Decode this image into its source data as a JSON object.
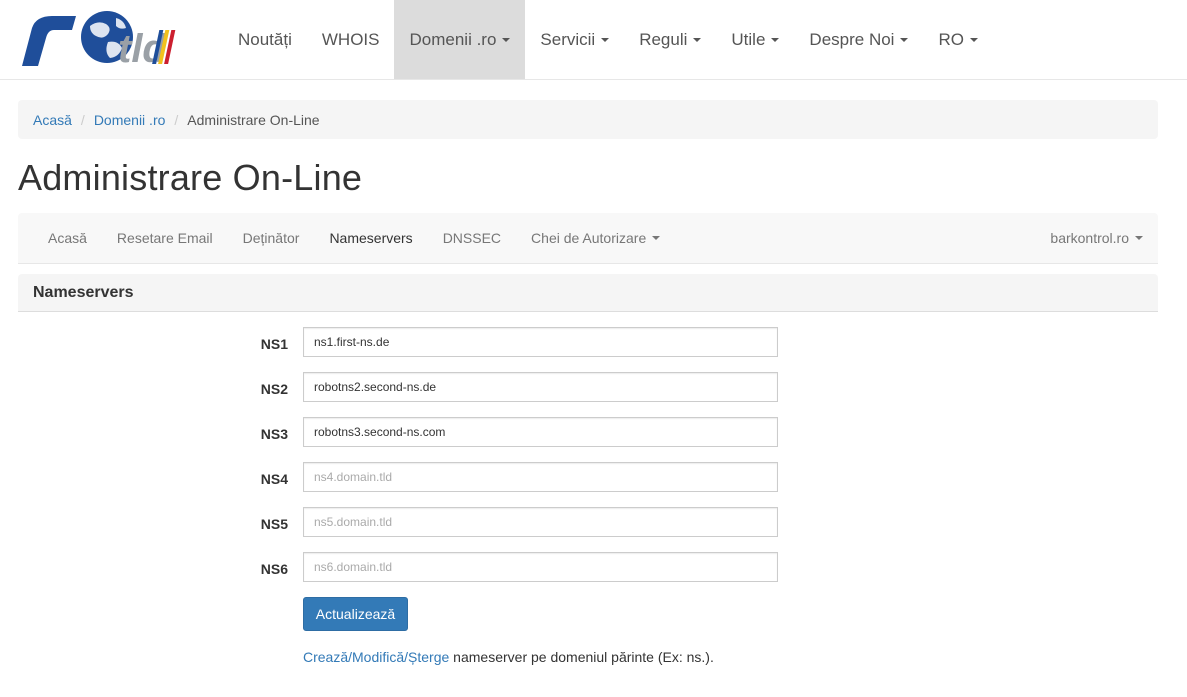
{
  "logo": {
    "text": "rotld"
  },
  "topnav": {
    "items": [
      {
        "label": "Noutăți",
        "has_caret": false,
        "active": false
      },
      {
        "label": "WHOIS",
        "has_caret": false,
        "active": false
      },
      {
        "label": "Domenii .ro",
        "has_caret": true,
        "active": true
      },
      {
        "label": "Servicii",
        "has_caret": true,
        "active": false
      },
      {
        "label": "Reguli",
        "has_caret": true,
        "active": false
      },
      {
        "label": "Utile",
        "has_caret": true,
        "active": false
      },
      {
        "label": "Despre Noi",
        "has_caret": true,
        "active": false
      },
      {
        "label": "RO",
        "has_caret": true,
        "active": false
      }
    ]
  },
  "breadcrumb": {
    "home": "Acasă",
    "section": "Domenii .ro",
    "current": "Administrare On-Line",
    "separator": "/"
  },
  "page": {
    "title": "Administrare On-Line"
  },
  "subnav": {
    "items": [
      {
        "label": "Acasă"
      },
      {
        "label": "Resetare Email"
      },
      {
        "label": "Deținător"
      },
      {
        "label": "Nameservers"
      },
      {
        "label": "DNSSEC"
      },
      {
        "label": "Chei de Autorizare"
      }
    ],
    "active": "Nameservers",
    "domain_selector": "barkontrol.ro"
  },
  "panel": {
    "title": "Nameservers"
  },
  "form": {
    "fields": [
      {
        "label": "NS1",
        "value": "ns1.first-ns.de",
        "placeholder": ""
      },
      {
        "label": "NS2",
        "value": "robotns2.second-ns.de",
        "placeholder": ""
      },
      {
        "label": "NS3",
        "value": "robotns3.second-ns.com",
        "placeholder": ""
      },
      {
        "label": "NS4",
        "value": "",
        "placeholder": "ns4.domain.tld"
      },
      {
        "label": "NS5",
        "value": "",
        "placeholder": "ns5.domain.tld"
      },
      {
        "label": "NS6",
        "value": "",
        "placeholder": "ns6.domain.tld"
      }
    ],
    "submit_label": "Actualizează"
  },
  "note": {
    "link_text": "Crează/Modifică/Șterge",
    "text": " nameserver pe domeniul părinte (Ex: ns.)."
  },
  "colors": {
    "link": "#337ab7",
    "primary_button": "#337ab7",
    "active_nav_bg": "#dcdcdc",
    "logo_blue": "#1f4e9a",
    "logo_red": "#cc1f2f",
    "logo_yellow": "#f2c11d"
  }
}
